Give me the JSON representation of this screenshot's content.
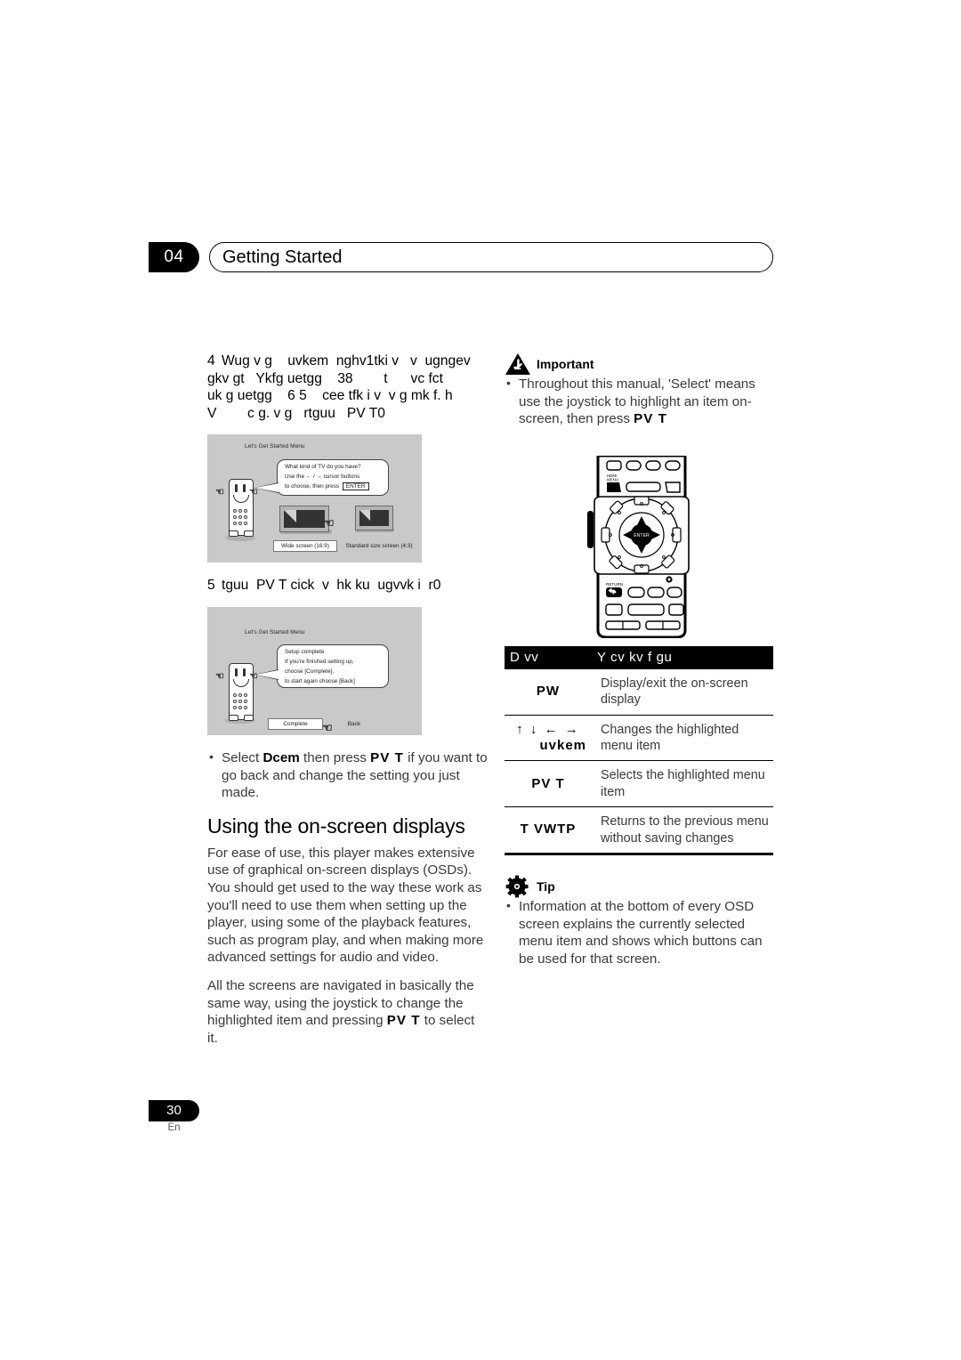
{
  "header": {
    "chapter_number": "04",
    "chapter_title": "Getting Started"
  },
  "left_column": {
    "step4": {
      "number": "4",
      "line1": "Wug v g    uvkem  nghv1tki v   v  ugngev",
      "line2": "gkv gt   Ykfg uetgg    38        t      vc fct",
      "line3": "uk g uetgg    6 5    cee tfk i v  v g mk f. h",
      "line4": "V        c g. v g   rtguu   PV T0"
    },
    "step5": {
      "number": "5",
      "text": "tguu  PV T cick  v  hk ku  ugvvk i  r0"
    },
    "note_bullet": {
      "prefix": "Select ",
      "bold": "Dcem",
      "middle": " then press ",
      "button": "PV T",
      "suffix": " if you want to go back and change the setting you just made."
    },
    "section": {
      "heading": "Using the on-screen displays",
      "para1": "For ease of use, this player makes extensive use of graphical on-screen displays (OSDs). You should get used to the way these work as you'll need to use them when setting up the player, using some of the playback features, such as program play, and when making more advanced settings for audio and video.",
      "para2_start": "All the screens are navigated in basically the same way, using the joystick to change the highlighted item and pressing ",
      "para2_button": "PV T",
      "para2_end": " to select it."
    }
  },
  "illustration_1": {
    "screen_title": "Let's Get Started Menu",
    "bubble_lines": [
      "What kind of TV do you have?",
      "Use the ← / → cursor buttons",
      "to choose, then press ENTER"
    ],
    "enter_key_label": "ENTER",
    "option_selected": "Wide screen (16:9)",
    "option_other": "Standard size screen (4:3)"
  },
  "illustration_2": {
    "screen_title": "Let's Get Started Menu",
    "bubble_lines": [
      "Setup complete",
      "If you're finished setting up,",
      "choose [Complete],",
      "to start again choose [Back]"
    ],
    "option_selected": "Complete",
    "option_other": "Back"
  },
  "remote": {
    "hdmi_menu_label": "HDMI MENU",
    "enter_label": "ENTER",
    "return_label": "RETURN"
  },
  "right_column": {
    "important": {
      "icon": "important-icon",
      "title": "Important",
      "bullet_start": "Throughout this manual, 'Select' means use the joystick to highlight an item on-screen, then press ",
      "bullet_button": "PV T"
    },
    "table": {
      "headers": [
        "D vv",
        "Y cv kv f gu"
      ],
      "rows": [
        {
          "key": "PW",
          "key_arrows": "",
          "key_sub": "",
          "desc": "Display/exit the on-screen display"
        },
        {
          "key": "",
          "key_arrows": "↑ ↓ ← →",
          "key_sub": "uvkem",
          "desc": "Changes the highlighted menu item"
        },
        {
          "key": "PV T",
          "key_arrows": "",
          "key_sub": "",
          "desc": "Selects the highlighted menu item"
        },
        {
          "key": "T VWTP",
          "key_arrows": "",
          "key_sub": "",
          "desc": "Returns to the previous menu without saving changes"
        }
      ]
    },
    "tip": {
      "icon": "tip-icon",
      "title": "Tip",
      "bullet": "Information at the bottom of every OSD screen explains the currently selected menu item and shows which buttons can be used for that screen."
    }
  },
  "footer": {
    "page_number": "30",
    "language": "En"
  },
  "colors": {
    "ink": "#000000",
    "body_text": "#3a3a3a",
    "illustration_bg": "#c9c9c9"
  }
}
